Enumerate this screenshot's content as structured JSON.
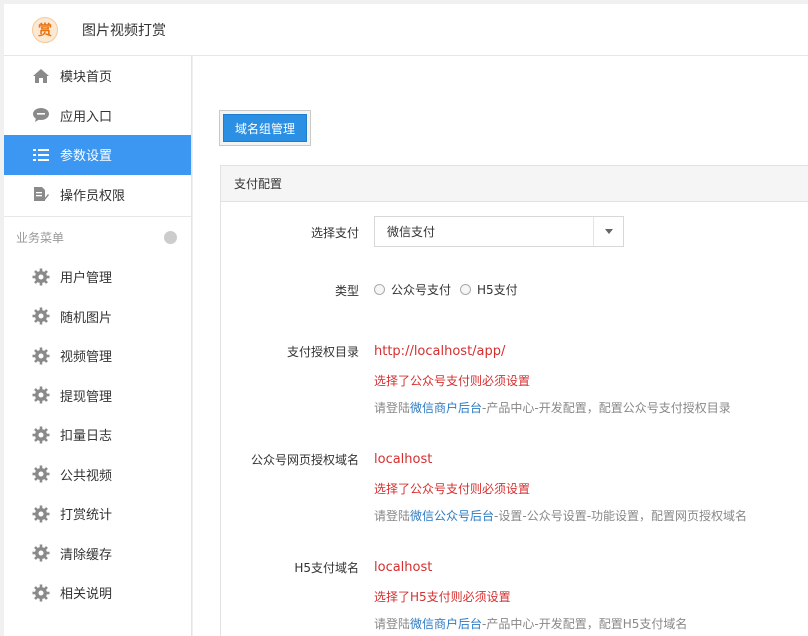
{
  "header": {
    "logo_char": "赏",
    "title": "图片视频打赏"
  },
  "sidebar": {
    "items": [
      {
        "label": "模块首页",
        "icon": "home-icon"
      },
      {
        "label": "应用入口",
        "icon": "chat-bubble-icon"
      },
      {
        "label": "参数设置",
        "icon": "list-settings-icon",
        "active": true
      },
      {
        "label": "操作员权限",
        "icon": "document-edit-icon"
      }
    ],
    "section_title": "业务菜单",
    "business_items": [
      {
        "label": "用户管理",
        "icon": "gear-icon"
      },
      {
        "label": "随机图片",
        "icon": "gear-icon"
      },
      {
        "label": "视频管理",
        "icon": "gear-icon"
      },
      {
        "label": "提现管理",
        "icon": "gear-icon"
      },
      {
        "label": "扣量日志",
        "icon": "gear-icon"
      },
      {
        "label": "公共视频",
        "icon": "gear-icon"
      },
      {
        "label": "打赏统计",
        "icon": "gear-icon"
      },
      {
        "label": "清除缓存",
        "icon": "gear-icon"
      },
      {
        "label": "相关说明",
        "icon": "gear-icon"
      }
    ]
  },
  "toolbar": {
    "domain_group_button": "域名组管理"
  },
  "panel": {
    "title": "支付配置",
    "payment_select": {
      "label": "选择支付",
      "value": "微信支付"
    },
    "type": {
      "label": "类型",
      "options": [
        "公众号支付",
        "H5支付"
      ]
    },
    "auth_dir": {
      "label": "支付授权目录",
      "value": "http://localhost/app/",
      "warning": "选择了公众号支付则必须设置",
      "hint_prefix": "请登陆",
      "hint_link": "微信商户后台",
      "hint_suffix": "-产品中心-开发配置，配置公众号支付授权目录"
    },
    "oauth_domain": {
      "label": "公众号网页授权域名",
      "value": "localhost",
      "warning": "选择了公众号支付则必须设置",
      "hint_prefix": "请登陆",
      "hint_link": "微信公众号后台",
      "hint_suffix": "-设置-公众号设置-功能设置，配置网页授权域名"
    },
    "h5_domain": {
      "label": "H5支付域名",
      "value": "localhost",
      "warning": "选择了H5支付则必须设置",
      "hint_prefix": "请登陆",
      "hint_link": "微信商户后台",
      "hint_suffix": "-产品中心-开发配置，配置H5支付域名"
    }
  }
}
